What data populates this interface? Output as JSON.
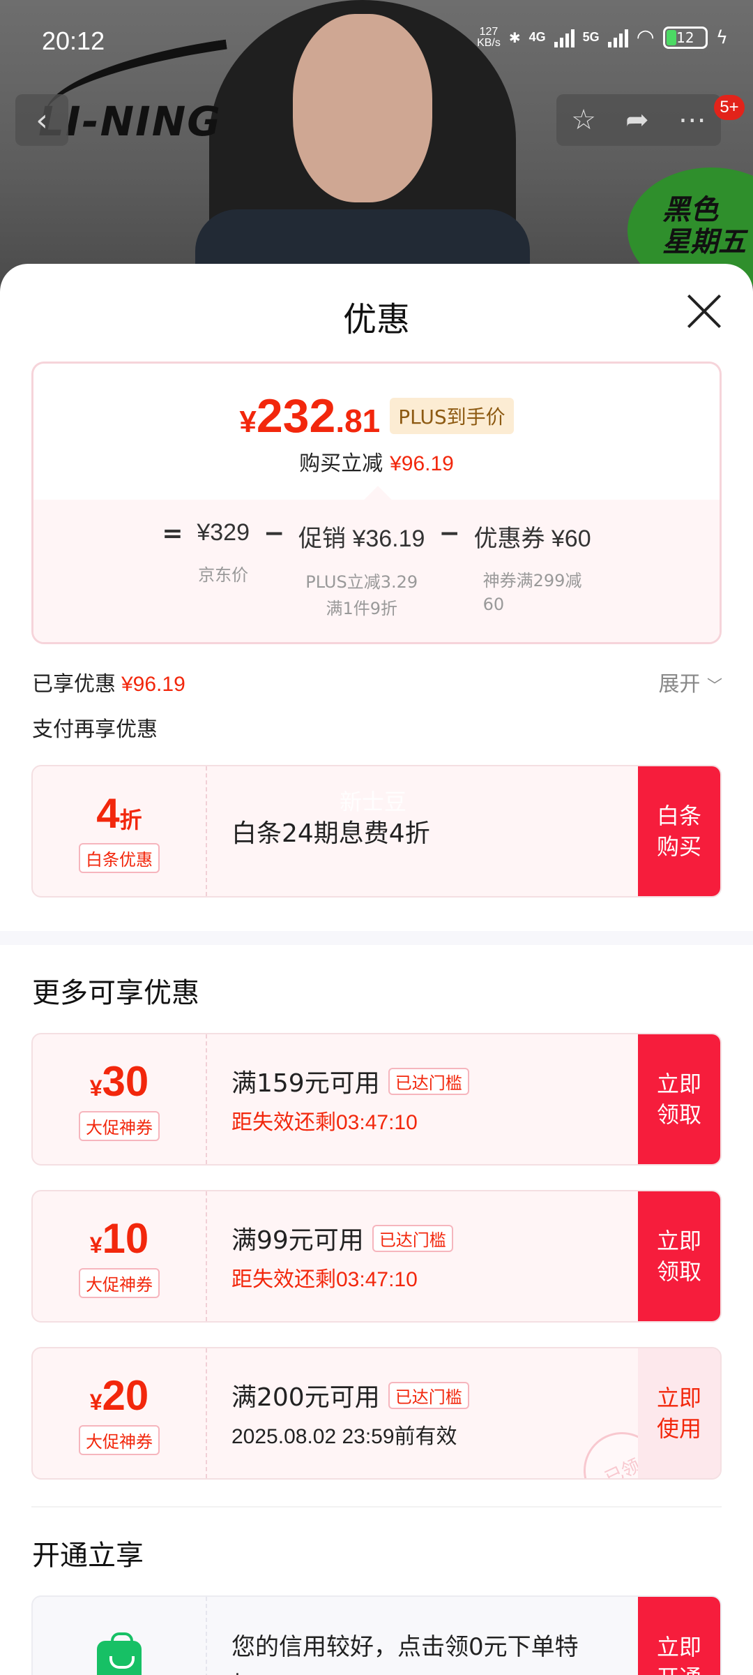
{
  "status_bar": {
    "time": "20:12",
    "net_speed_value": "127",
    "net_speed_unit": "KB/s",
    "sig1": "4G",
    "sig2": "5G",
    "battery": "12"
  },
  "background": {
    "brand_logo": "LI-NING",
    "promo_badge_line1": "黑色",
    "promo_badge_line2": "星期五",
    "message_badge": "5+"
  },
  "icons": {
    "back": "back-icon",
    "star": "star-icon",
    "share": "share-icon",
    "more": "more-icon",
    "close": "close-icon",
    "chevron": "chevron-down-icon",
    "app": "shopping-bag-icon"
  },
  "sheet": {
    "title": "优惠",
    "price": {
      "yen": "¥",
      "integer": "232",
      "decimal": ".81",
      "plus_tag": "PLUS到手价",
      "instant_label": "购买立减",
      "instant_value": "¥96.19"
    },
    "breakdown": {
      "eq": "=",
      "jd_price": "¥329",
      "jd_price_label": "京东价",
      "minus1": "−",
      "promo": "促销 ¥36.19",
      "promo_sub1": "PLUS立减3.29",
      "promo_sub2": "满1件9折",
      "minus2": "−",
      "coupon": "优惠券 ¥60",
      "coupon_sub1": "神券满299减",
      "coupon_sub2": "60"
    },
    "enjoyed_label": "已享优惠",
    "enjoyed_value": "¥96.19",
    "expand_label": "展开",
    "pay_more_label": "支付再享优惠",
    "baitiao": {
      "amount": "4",
      "unit": "折",
      "tag": "白条优惠",
      "title": "白条24期息费4折",
      "watermark": "新士豆",
      "button_line1": "白条",
      "button_line2": "购买"
    },
    "more_section_title": "更多可享优惠",
    "coupons": [
      {
        "yen": "¥",
        "amount": "30",
        "tag": "大促神券",
        "title": "满159元可用",
        "reach": "已达门槛",
        "sub": "距失效还剩03:47:10",
        "btn1": "立即",
        "btn2": "领取"
      },
      {
        "yen": "¥",
        "amount": "10",
        "tag": "大促神券",
        "title": "满99元可用",
        "reach": "已达门槛",
        "sub": "距失效还剩03:47:10",
        "btn1": "立即",
        "btn2": "领取"
      },
      {
        "yen": "¥",
        "amount": "20",
        "tag": "大促神券",
        "title": "满200元可用",
        "reach": "已达门槛",
        "sub": "2025.08.02 23:59前有效",
        "btn1": "立即",
        "btn2": "使用",
        "stamp": "已领"
      }
    ],
    "open_section_title": "开通立享",
    "open_item": {
      "title": "您的信用较好，点击领0元下单特",
      "title_cont": "权",
      "btn1": "立即",
      "btn2": "开通"
    }
  }
}
